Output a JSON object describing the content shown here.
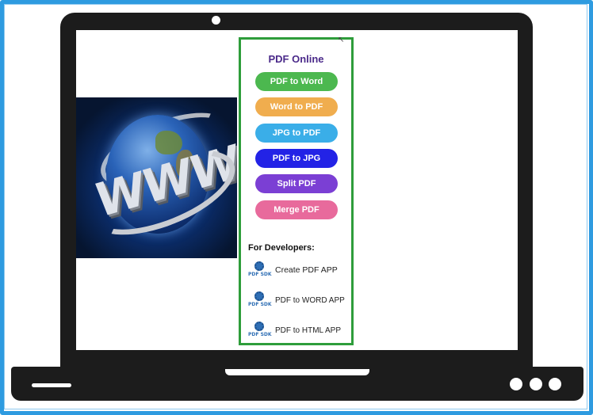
{
  "panel": {
    "title": "PDF Online",
    "buttons": [
      {
        "label": "PDF to Word",
        "color": "#4cb84f"
      },
      {
        "label": "Word to PDF",
        "color": "#f0ad4e"
      },
      {
        "label": "JPG to PDF",
        "color": "#3aaee8"
      },
      {
        "label": "PDF to JPG",
        "color": "#2323e6"
      },
      {
        "label": "Split PDF",
        "color": "#7b3fd4"
      },
      {
        "label": "Merge PDF",
        "color": "#e86a9c"
      }
    ],
    "developers": {
      "heading": "For Developers:",
      "items": [
        {
          "label": "Create PDF APP",
          "icon": "pdf-sdk-gear-icon",
          "icon_text": "PDF SDK"
        },
        {
          "label": "PDF to WORD APP",
          "icon": "pdf-sdk-gear-icon",
          "icon_text": "PDF SDK"
        },
        {
          "label": "PDF to HTML APP",
          "icon": "pdf-sdk-gear-icon",
          "icon_text": "PDF SDK"
        }
      ]
    },
    "border_color": "#2e9d3b",
    "title_color": "#4b2a8a"
  },
  "hero_image": {
    "text": "WWW",
    "icon": "globe-icon"
  },
  "frame": {
    "border_color": "#2e9be0",
    "laptop_color": "#1c1c1c"
  }
}
